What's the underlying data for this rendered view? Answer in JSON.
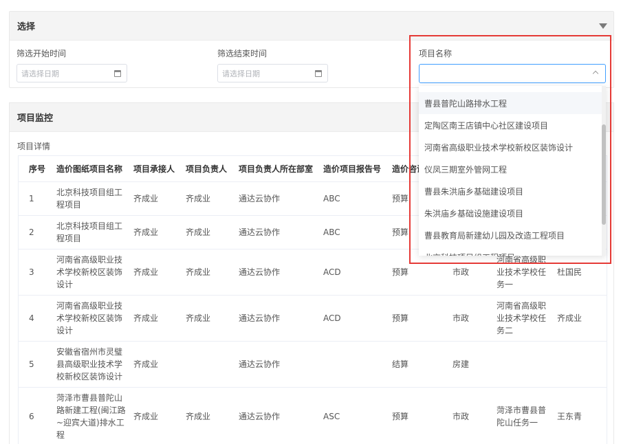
{
  "filter": {
    "title": "选择",
    "start_label": "筛选开始时间",
    "end_label": "筛选结束时间",
    "project_label": "项目名称",
    "date_placeholder": "请选择日期"
  },
  "monitor": {
    "title": "项目监控",
    "detail_label": "项目详情",
    "columns": [
      "序号",
      "造价图纸项目名称",
      "项目承接人",
      "项目负责人",
      "项目负责人所在部室",
      "造价项目报告号",
      "造价咨询",
      "",
      "",
      ""
    ],
    "rows": [
      [
        "1",
        "北京科技项目组工程项目",
        "齐成业",
        "齐成业",
        "通达云协作",
        "ABC",
        "预算",
        "",
        "",
        ""
      ],
      [
        "2",
        "北京科技项目组工程项目",
        "齐成业",
        "齐成业",
        "通达云协作",
        "ABC",
        "预算",
        "",
        "",
        ""
      ],
      [
        "3",
        "河南省高级职业技术学校新校区装饰设计",
        "齐成业",
        "齐成业",
        "通达云协作",
        "ACD",
        "预算",
        "市政",
        "河南省高级职业技术学校任务一",
        "杜国民"
      ],
      [
        "4",
        "河南省高级职业技术学校新校区装饰设计",
        "齐成业",
        "齐成业",
        "通达云协作",
        "ACD",
        "预算",
        "市政",
        "河南省高级职业技术学校任务二",
        "齐成业"
      ],
      [
        "5",
        "安徽省宿州市灵璧县高级职业技术学校新校区装饰设计",
        "齐成业",
        "",
        "通达云协作",
        "",
        "结算",
        "房建",
        "",
        ""
      ],
      [
        "6",
        "菏泽市曹县普陀山路新建工程(闽江路~迎宾大道)排水工程",
        "齐成业",
        "齐成业",
        "通达云协作",
        "ASC",
        "预算",
        "市政",
        "菏泽市曹县普陀山任务一",
        "王东青"
      ]
    ]
  },
  "dropdown": {
    "options": [
      "曹县普陀山路排水工程",
      "定陶区南王店镇中心社区建设项目",
      "河南省高级职业技术学校新校区装饰设计",
      "仪凤三期室外管网工程",
      "曹县朱洪庙乡基础建设项目",
      "朱洪庙乡基础设施建设项目",
      "曹县教育局新建幼儿园及改造工程项目",
      "北京科技项目组工程项目"
    ]
  },
  "colors": {
    "highlight": "#e53935",
    "focus": "#409eff"
  }
}
